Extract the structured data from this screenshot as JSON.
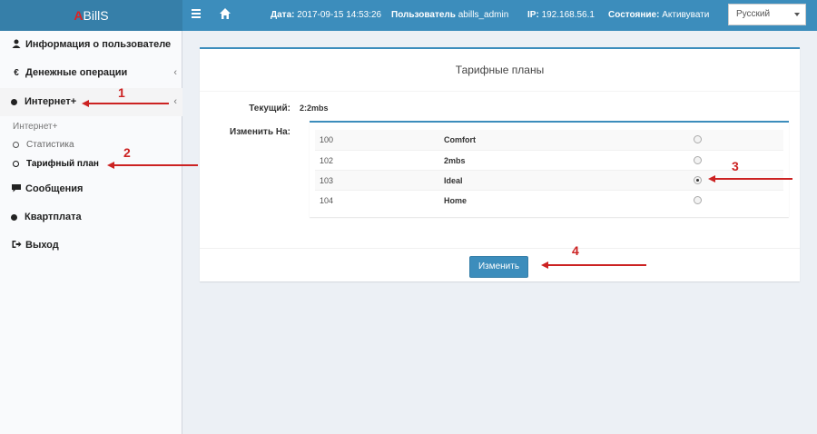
{
  "header": {
    "logo_prefix": "A",
    "logo_rest": "BillS",
    "date_label": "Дата:",
    "date_value": "2017-09-15 14:53:26",
    "user_label": "Пользователь",
    "user_value": "abills_admin",
    "ip_label": "IP:",
    "ip_value": "192.168.56.1",
    "state_label": "Состояние:",
    "state_value": "Активувати",
    "language": "Русский"
  },
  "sidebar": {
    "items": [
      {
        "label": "Информация о пользователе",
        "icon": "user-icon"
      },
      {
        "label": "Денежные операции",
        "icon": "euro-icon"
      },
      {
        "label": "Интернет+",
        "icon": "circle-icon"
      },
      {
        "label": "Сообщения",
        "icon": "message-icon"
      },
      {
        "label": "Квартплата",
        "icon": "circle-icon"
      },
      {
        "label": "Выход",
        "icon": "logout-icon"
      }
    ],
    "submenu_title": "Интернет+",
    "submenu": [
      {
        "label": "Статистика"
      },
      {
        "label": "Тарифный план"
      }
    ]
  },
  "main": {
    "title": "Тарифные планы",
    "current_label": "Текущий:",
    "current_value": "2:2mbs",
    "change_label": "Изменить На:",
    "plans": [
      {
        "id": "100",
        "name": "Comfort",
        "selected": false
      },
      {
        "id": "102",
        "name": "2mbs",
        "selected": false
      },
      {
        "id": "103",
        "name": "Ideal",
        "selected": true
      },
      {
        "id": "104",
        "name": "Home",
        "selected": false
      }
    ],
    "submit_label": "Изменить"
  },
  "annotations": [
    "1",
    "2",
    "3",
    "4"
  ],
  "colors": {
    "accent": "#3c8dbc",
    "annotation": "#cc2222"
  }
}
